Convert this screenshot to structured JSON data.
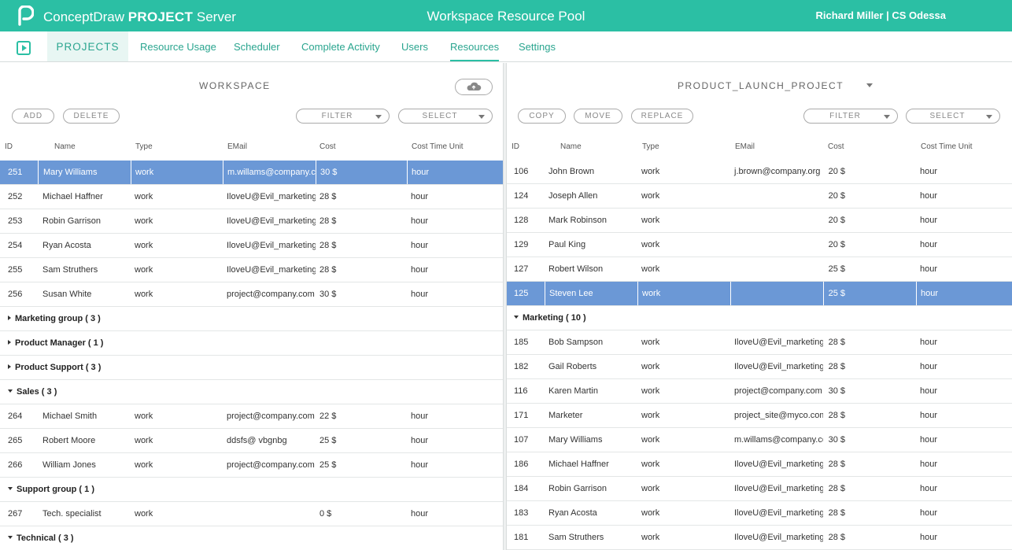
{
  "app": {
    "name": "ConceptDraw",
    "name_bold": "PROJECT",
    "name_suffix": "Server",
    "page_title": "Workspace Resource Pool",
    "user": "Richard Miller",
    "org": "CS Odessa"
  },
  "nav": {
    "tabs": [
      "PROJECTS",
      "Resource Usage",
      "Scheduler",
      "Complete Activity",
      "Users",
      "Resources",
      "Settings"
    ],
    "active": "Resources"
  },
  "left": {
    "title": "WORKSPACE",
    "buttons": {
      "add": "ADD",
      "delete": "DELETE",
      "filter": "FILTER",
      "select": "SELECT"
    },
    "columns": [
      "ID",
      "Name",
      "Type",
      "EMail",
      "Cost",
      "Cost Time Unit"
    ],
    "rows": [
      {
        "kind": "row",
        "cells": [
          "251",
          "Mary Williams",
          "work",
          "m.willams@company.com",
          "30 $",
          "hour"
        ],
        "selected": true
      },
      {
        "kind": "row",
        "cells": [
          "252",
          "Michael Haffner",
          "work",
          "IloveU@Evil_marketing",
          "28 $",
          "hour"
        ]
      },
      {
        "kind": "row",
        "cells": [
          "253",
          "Robin Garrison",
          "work",
          "IloveU@Evil_marketing",
          "28 $",
          "hour"
        ]
      },
      {
        "kind": "row",
        "cells": [
          "254",
          "Ryan Acosta",
          "work",
          "IloveU@Evil_marketing",
          "28 $",
          "hour"
        ]
      },
      {
        "kind": "row",
        "cells": [
          "255",
          "Sam Struthers",
          "work",
          "IloveU@Evil_marketing",
          "28 $",
          "hour"
        ]
      },
      {
        "kind": "row",
        "cells": [
          "256",
          "Susan White",
          "work",
          "project@company.com",
          "30 $",
          "hour"
        ]
      },
      {
        "kind": "group",
        "label": "Marketing group ( 3 )",
        "expanded": false
      },
      {
        "kind": "group",
        "label": "Product Manager ( 1 )",
        "expanded": false
      },
      {
        "kind": "group",
        "label": "Product Support ( 3 )",
        "expanded": false
      },
      {
        "kind": "group",
        "label": "Sales ( 3 )",
        "expanded": true
      },
      {
        "kind": "row",
        "cells": [
          "264",
          "Michael Smith",
          "work",
          "project@company.com",
          "22 $",
          "hour"
        ]
      },
      {
        "kind": "row",
        "cells": [
          "265",
          "Robert Moore",
          "work",
          "ddsfs@ vbgnbg",
          "25 $",
          "hour"
        ]
      },
      {
        "kind": "row",
        "cells": [
          "266",
          "William Jones",
          "work",
          "project@company.com",
          "25 $",
          "hour"
        ]
      },
      {
        "kind": "group",
        "label": "Support group ( 1 )",
        "expanded": true
      },
      {
        "kind": "row",
        "cells": [
          "267",
          "Tech. specialist",
          "work",
          "",
          "0 $",
          "hour"
        ]
      },
      {
        "kind": "group",
        "label": "Technical ( 3 )",
        "expanded": true
      }
    ]
  },
  "right": {
    "title": "PRODUCT_LAUNCH_PROJECT",
    "buttons": {
      "copy": "COPY",
      "move": "MOVE",
      "replace": "REPLACE",
      "filter": "FILTER",
      "select": "SELECT"
    },
    "columns": [
      "ID",
      "Name",
      "Type",
      "EMail",
      "Cost",
      "Cost Time Unit"
    ],
    "rows": [
      {
        "kind": "row",
        "cells": [
          "106",
          "John Brown",
          "work",
          "j.brown@company.org",
          "20 $",
          "hour"
        ]
      },
      {
        "kind": "row",
        "cells": [
          "124",
          "Joseph Allen",
          "work",
          "",
          "20 $",
          "hour"
        ]
      },
      {
        "kind": "row",
        "cells": [
          "128",
          "Mark Robinson",
          "work",
          "",
          "20 $",
          "hour"
        ]
      },
      {
        "kind": "row",
        "cells": [
          "129",
          "Paul King",
          "work",
          "",
          "20 $",
          "hour"
        ]
      },
      {
        "kind": "row",
        "cells": [
          "127",
          "Robert Wilson",
          "work",
          "",
          "25 $",
          "hour"
        ]
      },
      {
        "kind": "row",
        "cells": [
          "125",
          "Steven Lee",
          "work",
          "",
          "25 $",
          "hour"
        ],
        "selected": true
      },
      {
        "kind": "group",
        "label": "Marketing ( 10 )",
        "expanded": true
      },
      {
        "kind": "row",
        "cells": [
          "185",
          "Bob Sampson",
          "work",
          "IloveU@Evil_marketing",
          "28 $",
          "hour"
        ]
      },
      {
        "kind": "row",
        "cells": [
          "182",
          "Gail Roberts",
          "work",
          "IloveU@Evil_marketing",
          "28 $",
          "hour"
        ]
      },
      {
        "kind": "row",
        "cells": [
          "116",
          "Karen Martin",
          "work",
          "project@company.com",
          "30 $",
          "hour"
        ]
      },
      {
        "kind": "row",
        "cells": [
          "171",
          "Marketer",
          "work",
          "project_site@myco.com",
          "28 $",
          "hour"
        ]
      },
      {
        "kind": "row",
        "cells": [
          "107",
          "Mary Williams",
          "work",
          "m.willams@company.com",
          "30 $",
          "hour"
        ]
      },
      {
        "kind": "row",
        "cells": [
          "186",
          "Michael Haffner",
          "work",
          "IloveU@Evil_marketing",
          "28 $",
          "hour"
        ]
      },
      {
        "kind": "row",
        "cells": [
          "184",
          "Robin Garrison",
          "work",
          "IloveU@Evil_marketing",
          "28 $",
          "hour"
        ]
      },
      {
        "kind": "row",
        "cells": [
          "183",
          "Ryan Acosta",
          "work",
          "IloveU@Evil_marketing",
          "28 $",
          "hour"
        ]
      },
      {
        "kind": "row",
        "cells": [
          "181",
          "Sam Struthers",
          "work",
          "IloveU@Evil_marketing",
          "28 $",
          "hour"
        ]
      }
    ]
  },
  "colors": {
    "accent": "#2bbfa4",
    "selected_row": "#6b98d6",
    "nav_text": "#2aa58f"
  },
  "icons": [
    "conceptdraw-logo-icon",
    "play-icon",
    "cloud-upload-icon",
    "dropdown-caret-icon",
    "group-expand-icon",
    "group-collapse-icon"
  ]
}
